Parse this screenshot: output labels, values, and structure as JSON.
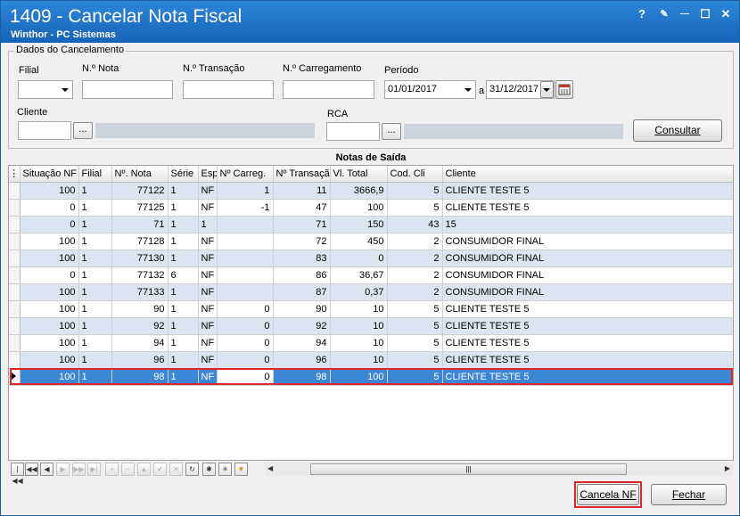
{
  "titlebar": {
    "title": "1409 - Cancelar Nota Fiscal",
    "subtitle": "Winthor - PC Sistemas",
    "help_glyph": "?",
    "edit_glyph": "✎",
    "minimize_glyph": "—",
    "maximize_glyph": "☐",
    "close_glyph": "✕"
  },
  "filters": {
    "group_title": "Dados do Cancelamento",
    "filial_label": "Filial",
    "nota_label": "N.º Nota",
    "transacao_label": "N.º Transação",
    "carregamento_label": "N.º Carregamento",
    "periodo_label": "Período",
    "periodo_start": "01/01/2017",
    "periodo_sep": "a",
    "periodo_end": "31/12/2017",
    "cliente_label": "Cliente",
    "rca_label": "RCA",
    "ellipsis": "...",
    "consultar_label": "Consultar"
  },
  "grid": {
    "title": "Notas de Saída",
    "columns": [
      "Situação NF",
      "Filial",
      "Nº. Nota",
      "Série",
      "Esp",
      "Nº Carreg.",
      "Nº Transação",
      "Vl. Total",
      "Cod. Cli",
      "Cliente"
    ],
    "rows": [
      [
        "100",
        "1",
        "77122",
        "1",
        "NF",
        "1",
        "11",
        "3666,9",
        "5",
        "CLIENTE TESTE 5"
      ],
      [
        "0",
        "1",
        "77125",
        "1",
        "NF",
        "-1",
        "47",
        "100",
        "5",
        "CLIENTE TESTE 5"
      ],
      [
        "0",
        "1",
        "71",
        "1",
        "1",
        "",
        "71",
        "150",
        "43",
        "15"
      ],
      [
        "100",
        "1",
        "77128",
        "1",
        "NF",
        "",
        "72",
        "450",
        "2",
        "CONSUMIDOR FINAL"
      ],
      [
        "100",
        "1",
        "77130",
        "1",
        "NF",
        "",
        "83",
        "0",
        "2",
        "CONSUMIDOR FINAL"
      ],
      [
        "0",
        "1",
        "77132",
        "6",
        "NF",
        "",
        "86",
        "36,67",
        "2",
        "CONSUMIDOR FINAL"
      ],
      [
        "100",
        "1",
        "77133",
        "1",
        "NF",
        "",
        "87",
        "0,37",
        "2",
        "CONSUMIDOR FINAL"
      ],
      [
        "100",
        "1",
        "90",
        "1",
        "NF",
        "0",
        "90",
        "10",
        "5",
        "CLIENTE TESTE 5"
      ],
      [
        "100",
        "1",
        "92",
        "1",
        "NF",
        "0",
        "92",
        "10",
        "5",
        "CLIENTE TESTE 5"
      ],
      [
        "100",
        "1",
        "94",
        "1",
        "NF",
        "0",
        "94",
        "10",
        "5",
        "CLIENTE TESTE 5"
      ],
      [
        "100",
        "1",
        "96",
        "1",
        "NF",
        "0",
        "96",
        "10",
        "5",
        "CLIENTE TESTE 5"
      ],
      [
        "100",
        "1",
        "98",
        "1",
        "NF",
        "0",
        "98",
        "100",
        "5",
        "CLIENTE TESTE 5"
      ]
    ],
    "selected_row": 11
  },
  "navigator": {
    "buttons": [
      "first-page",
      "prev-page",
      "prev",
      "next",
      "next-page",
      "last",
      "insert",
      "delete",
      "edit",
      "post",
      "cancel",
      "refresh",
      "save-bookmark",
      "goto-bookmark",
      "filter"
    ],
    "glyphs": [
      "|◀◀",
      "◀◀",
      "◀",
      "▶",
      "▶▶",
      "▶|",
      "+",
      "−",
      "▲",
      "✔",
      "✕",
      "↻",
      "✱",
      "✳",
      "▼"
    ],
    "scroll_glyph": "|||",
    "left_arrow": "◀",
    "right_arrow": "▶"
  },
  "footer": {
    "cancela_label": "Cancela NF",
    "fechar_label": "Fechar"
  },
  "colors": {
    "titlebar": "#1663b8",
    "row_alt": "#dbe5f1",
    "row_selected": "#3a87d6",
    "highlight": "#e0262a"
  }
}
